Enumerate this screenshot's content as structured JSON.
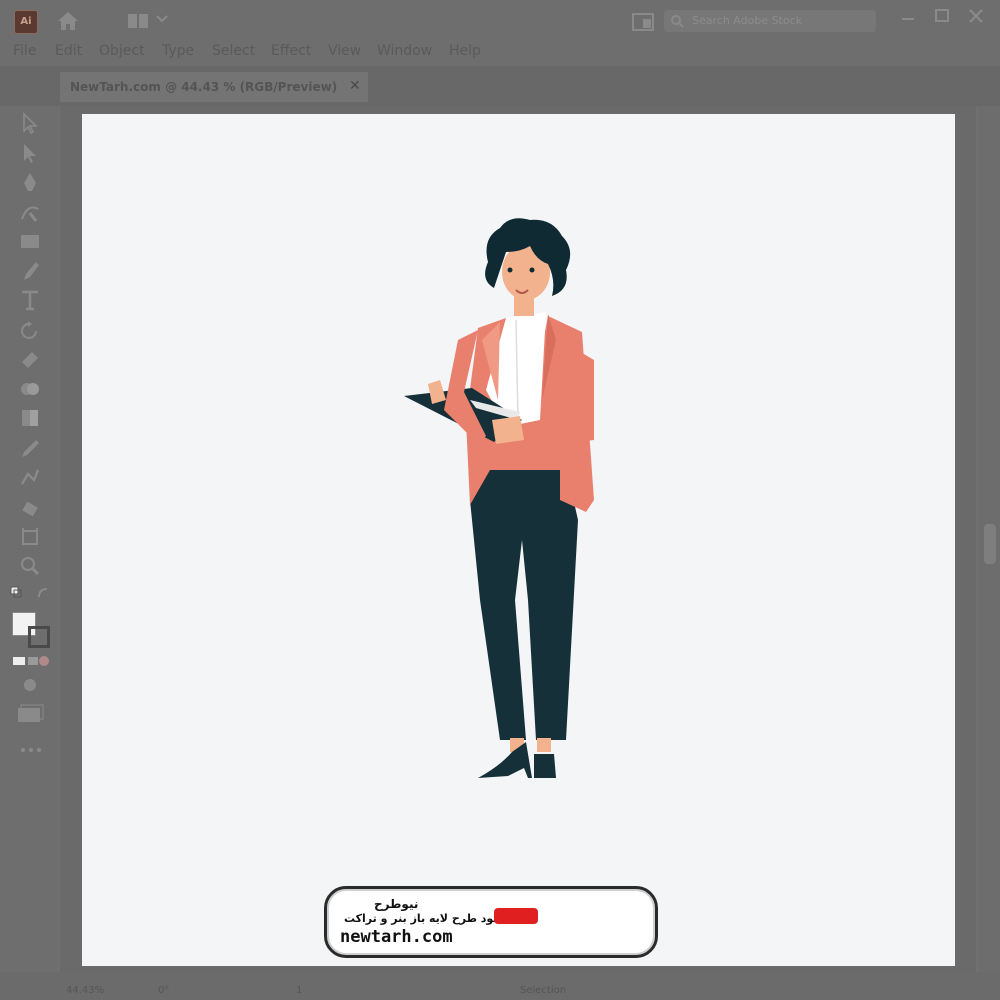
{
  "app": {
    "logo_text": "Ai",
    "search_placeholder": "Search Adobe Stock"
  },
  "menu": [
    "File",
    "Edit",
    "Object",
    "Type",
    "Select",
    "Effect",
    "View",
    "Window",
    "Help"
  ],
  "document_tab": {
    "title": "NewTarh.com @ 44.43 % (RGB/Preview)",
    "close": "✕"
  },
  "tools": [
    "selection-tool",
    "direct-selection-tool",
    "pen-tool",
    "curvature-tool",
    "rectangle-tool",
    "paintbrush-tool",
    "type-tool",
    "rotate-tool",
    "eraser-tool",
    "shape-builder-tool",
    "gradient-tool",
    "eyedropper-tool",
    "blend-tool",
    "symbol-sprayer-tool",
    "artboard-tool",
    "zoom-tool"
  ],
  "status": {
    "zoom": "44.43%",
    "rotation": "0°",
    "page": "1",
    "mode": "Selection"
  },
  "colors": {
    "jacket": "#e8806d",
    "pants": "#163039",
    "shirt": "#ffffff",
    "skin": "#f2b28e",
    "hair": "#0f2a33",
    "artboard": "#f4f5f7"
  },
  "watermark": {
    "title": "نیوطرح",
    "subtitle": "دانلود طرح لایه باز بنر و تراکت",
    "url": "newtarh.com",
    "logo_text": "نیوطرح"
  }
}
